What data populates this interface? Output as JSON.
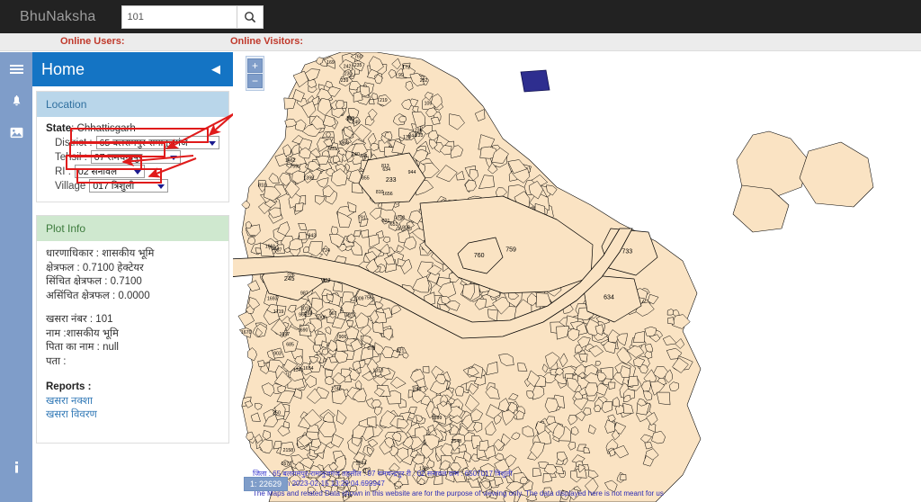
{
  "navbar": {
    "brand": "BhuNaksha",
    "search_value": "101",
    "search_placeholder": "",
    "search_icon": "search-icon"
  },
  "status_strip": {
    "online_users_label": "Online Users:",
    "online_visitors_label": "Online Visitors:"
  },
  "rail": {
    "items": [
      {
        "icon": "bell-icon",
        "label": ""
      },
      {
        "icon": "image-icon",
        "label": ""
      }
    ],
    "bottom": {
      "icon": "info-icon",
      "label": ""
    }
  },
  "panel": {
    "title": "Home",
    "menu_icon": "hamburger-icon",
    "collapse_icon": "chevron-left-icon",
    "location": {
      "header": "Location",
      "state_label": "State",
      "state_value": "Chhattisgarh",
      "fields": [
        {
          "label": "District :",
          "value": "65 बलरामपुर-रामानुजगंज",
          "name": "district-select"
        },
        {
          "label": "Tehsil :",
          "value": "07 रामचन्द्रपुर",
          "name": "tehsil-select"
        },
        {
          "label": "RI :",
          "value": "02 सनावल",
          "name": "ri-select"
        },
        {
          "label": "Village",
          "value": "017 त्रिशुली",
          "name": "village-select"
        }
      ]
    },
    "plot_info": {
      "header": "Plot Info",
      "lines_group1": [
        "धारणाधिकार : शासकीय भूमि",
        "क्षेत्रफल : 0.7100 हेक्टेयर",
        "सिंचित क्षेत्रफल : 0.7100",
        "असिंचित क्षेत्रफल : 0.0000"
      ],
      "lines_group2": [
        "खसरा नंबर : 101",
        "नाम :शासकीय भूमि",
        "पिता का नाम : null",
        "पता :"
      ],
      "reports_label": "Reports :",
      "report_links": [
        "खसरा नक्शा",
        "खसरा विवरण"
      ]
    }
  },
  "map": {
    "zoom_in_label": "+",
    "zoom_out_label": "−",
    "scale_text": "1: 22629",
    "attribution": {
      "line1": "जिला : 65 बलरामपुर-रामानुजगंज  तहसील : 07 रामचन्द्रपुर  री : 02 सनावल  ग्राम : 6507017 त्रिशुली",
      "line2": "Updated on  2023-02-15 13:29:04.699947",
      "line3": "The Maps and related Data shown in this website are for the purpose of viewing only. The data displayed here is not meant for us"
    },
    "colors": {
      "parcel_fill": "#fae3c3",
      "parcel_stroke": "#000000",
      "selected_parcel": "#2e2e8f",
      "label_text": "#000000"
    },
    "selected_parcel_number": "101",
    "parcel_labels_sample": [
      "99",
      "105",
      "100",
      "179",
      "172",
      "231",
      "171",
      "232",
      "230",
      "219",
      "233",
      "169",
      "287",
      "235",
      "236",
      "245",
      "239",
      "244",
      "242",
      "240",
      "241",
      "759",
      "760",
      "813",
      "810",
      "818",
      "821",
      "808",
      "813",
      "855",
      "791",
      "943",
      "944",
      "587",
      "733",
      "634",
      "724",
      "1863",
      "1462",
      "651",
      "1399",
      "1700",
      "1661",
      "1656",
      "1654",
      "1693",
      "1672",
      "1719",
      "1697",
      "1670",
      "987",
      "966",
      "967",
      "903",
      "1006",
      "1018",
      "1009",
      "906",
      "226",
      "266",
      "756",
      "675",
      "690",
      "685",
      "113",
      "132",
      "221",
      "2548",
      "2544",
      "290",
      "250",
      "1745",
      "1677",
      "2158",
      "1899",
      "1341",
      "1414",
      "1313"
    ]
  },
  "annotations": {
    "color": "#e01b1b",
    "boxes": [
      {
        "name": "district-highlight"
      },
      {
        "name": "tehsil-highlight"
      },
      {
        "name": "ri-highlight"
      },
      {
        "name": "village-highlight"
      }
    ],
    "arrows": [
      {
        "name": "district-arrow"
      },
      {
        "name": "tehsil-arrow"
      },
      {
        "name": "ri-arrow"
      },
      {
        "name": "village-arrow"
      }
    ]
  }
}
